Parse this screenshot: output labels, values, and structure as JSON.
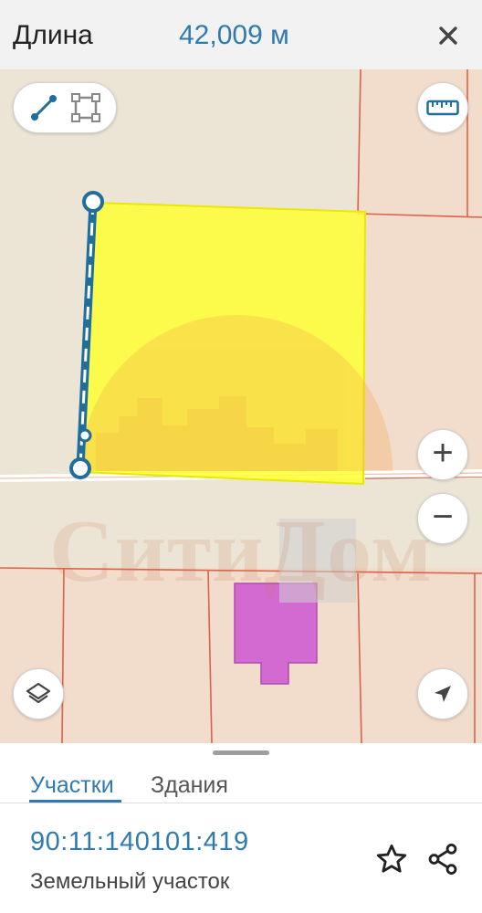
{
  "header": {
    "title": "Длина",
    "length_value": "42,009 м",
    "close_icon": "close-icon"
  },
  "map": {
    "watermark": "СитиДом",
    "tools": {
      "line_icon": "polyline-icon",
      "polygon_icon": "polygon-icon",
      "ruler_icon": "ruler-icon",
      "zoom_in": "+",
      "zoom_out": "−",
      "layers_icon": "layers-icon",
      "locate_icon": "navigation-arrow-icon"
    },
    "colors": {
      "background": "#ece5d5",
      "parcel": "#f2dccb",
      "boundary": "#d9644a",
      "selected_parcel": "#ffff33",
      "building": "#d26ad2",
      "measure_line": "#1f6e9c"
    }
  },
  "sheet": {
    "tabs": [
      {
        "label": "Участки",
        "active": true
      },
      {
        "label": "Здания",
        "active": false
      }
    ],
    "result": {
      "cadastral_number": "90:11:140101:419",
      "type": "Земельный участок"
    },
    "actions": {
      "favorite_icon": "star-icon",
      "share_icon": "share-icon"
    }
  }
}
